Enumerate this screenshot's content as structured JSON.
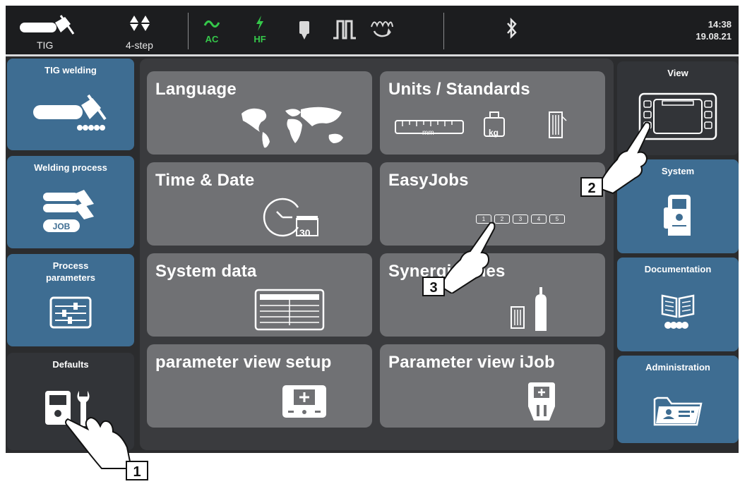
{
  "topbar": {
    "process_label": "TIG",
    "mode_label": "4-step",
    "ac_label": "AC",
    "hf_label": "HF",
    "time": "14:38",
    "date": "19.08.21",
    "icons": [
      "tig-torch-icon",
      "four-step-icon",
      "ac-wave-icon",
      "hf-icon",
      "gas-test-icon",
      "pulse-icon",
      "wire-threading-icon",
      "bluetooth-icon"
    ]
  },
  "left_nav": [
    {
      "label": "TIG welding",
      "icon": "tig-torch-icon"
    },
    {
      "label": "Welding process",
      "icon": "job-icon"
    },
    {
      "label": "Process parameters",
      "icon": "sliders-icon"
    },
    {
      "label": "Defaults",
      "icon": "device-wrench-icon"
    }
  ],
  "right_nav": [
    {
      "label": "View",
      "icon": "display-icon"
    },
    {
      "label": "System",
      "icon": "machine-icon"
    },
    {
      "label": "Documentation",
      "icon": "book-icon"
    },
    {
      "label": "Administration",
      "icon": "folder-id-icon"
    }
  ],
  "tiles": [
    {
      "label": "Language",
      "icon": "world-map-icon"
    },
    {
      "label": "Units / Standards",
      "icon": "ruler-weight-wire-icon",
      "unit_mm": "mm",
      "unit_kg": "kg"
    },
    {
      "label": "Time & Date",
      "icon": "clock-calendar-icon",
      "calendar_day": "30"
    },
    {
      "label": "EasyJobs",
      "icon": "job-slots-icon",
      "slots": [
        "1",
        "2",
        "3",
        "4",
        "5"
      ]
    },
    {
      "label": "System data",
      "icon": "data-table-icon"
    },
    {
      "label": "Synergic lines",
      "icon": "wire-gas-icon"
    },
    {
      "label": "parameter view setup",
      "icon": "display-plus-icon"
    },
    {
      "label": "Parameter view iJob",
      "icon": "remote-icon"
    }
  ],
  "callouts": [
    "1",
    "2",
    "3"
  ],
  "colors": {
    "active_blue": "#3e6d92",
    "tile_gray": "#707174",
    "ok_green": "#35c84a"
  }
}
